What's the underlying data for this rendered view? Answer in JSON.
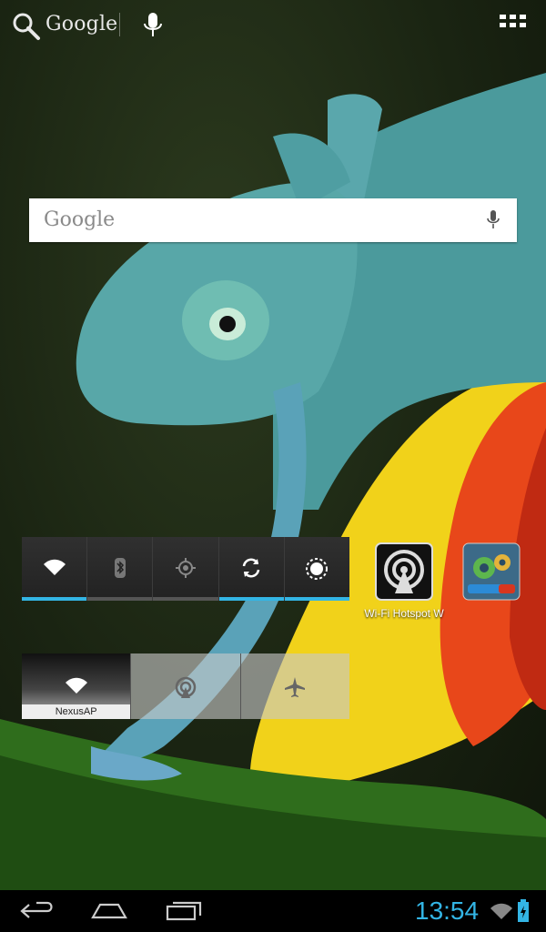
{
  "top_bar": {
    "search_label": "Google",
    "icons": [
      "search-icon",
      "mic-icon",
      "apps-grid-icon"
    ]
  },
  "search_widget": {
    "placeholder": "Google",
    "icon": "mic-icon"
  },
  "power_control": {
    "toggles": [
      {
        "name": "wifi",
        "icon": "wifi-icon",
        "on": true
      },
      {
        "name": "bluetooth",
        "icon": "bluetooth-icon",
        "on": false
      },
      {
        "name": "gps",
        "icon": "gps-icon",
        "on": false
      },
      {
        "name": "sync",
        "icon": "sync-icon",
        "on": true
      },
      {
        "name": "brightness",
        "icon": "brightness-icon",
        "on": true
      }
    ],
    "accent": "#33b5e5"
  },
  "apps": [
    {
      "label": "Wi-Fi Hotspot W",
      "icon": "wifi-hotspot-app-icon"
    },
    {
      "label": "",
      "icon": "settings-toolbox-app-icon"
    }
  ],
  "hotspot_widget": {
    "network_label": "NexusAP",
    "tiles": [
      "wifi-icon",
      "hotspot-icon",
      "airplane-icon"
    ]
  },
  "status_bar": {
    "time": "13:54",
    "icons": [
      "signal-icon",
      "battery-charging-icon"
    ]
  },
  "nav_bar": {
    "buttons": [
      "back-icon",
      "home-icon",
      "recent-apps-icon"
    ]
  }
}
